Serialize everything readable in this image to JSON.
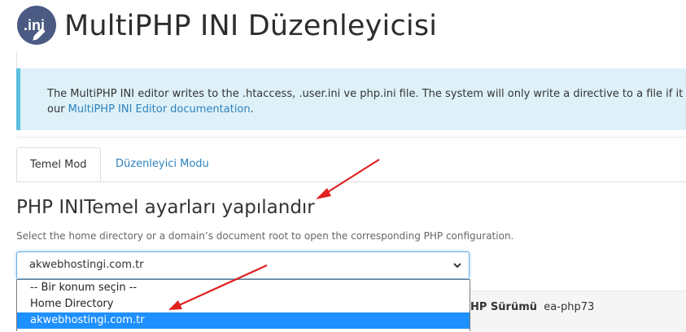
{
  "header": {
    "logo_text": ".ini",
    "title": "MultiPHP INI Düzenleyicisi"
  },
  "info": {
    "text": "The MultiPHP INI editor writes to the .htaccess, .user.ini ve php.ini file. The system will only write a directive to a file if it is",
    "text2": "our ",
    "link": "MultiPHP INI Editor documentation",
    "text3": "."
  },
  "tabs": [
    {
      "label": "Temel Mod",
      "active": true
    },
    {
      "label": "Düzenleyici Modu",
      "active": false
    }
  ],
  "section": {
    "heading": "PHP INITemel ayarları yapılandır",
    "help": "Select the home directory or a domain’s document root to open the corresponding PHP configuration."
  },
  "location_select": {
    "selected": "akwebhostingi.com.tr",
    "options": [
      "-- Bir konum seçin --",
      "Home Directory",
      "akwebhostingi.com.tr"
    ],
    "highlighted_index": 2
  },
  "behind_row": {
    "label": "HP Sürümü",
    "value": "ea-php73"
  },
  "colors": {
    "link": "#2c82be",
    "info_bg": "#def1f9",
    "info_border": "#5bc0de",
    "highlight": "#1e90ff",
    "annotation_arrow": "#e02020"
  }
}
